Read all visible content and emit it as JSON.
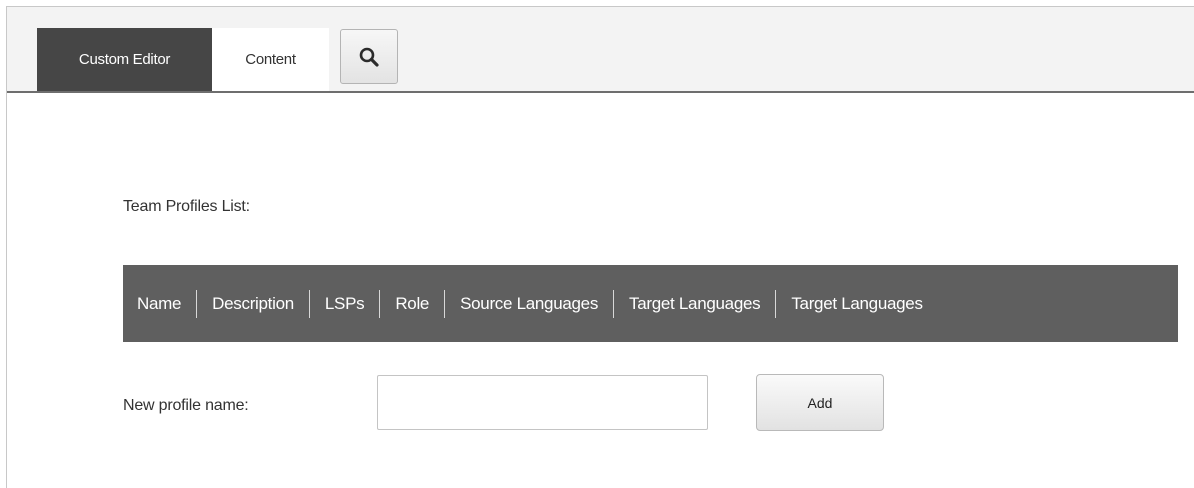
{
  "tabs": {
    "custom_editor": "Custom Editor",
    "content": "Content"
  },
  "toolbar": {
    "search_icon": "search-icon"
  },
  "profiles": {
    "list_title": "Team Profiles List:",
    "columns": [
      "Name",
      "Description",
      "LSPs",
      "Role",
      "Source Languages",
      "Target Languages",
      "Target Languages"
    ]
  },
  "new_profile": {
    "label": "New profile name:",
    "input_value": "",
    "add_label": "Add"
  },
  "colors": {
    "active_tab_bg": "#464646",
    "table_header_bg": "#5f5f5f",
    "toolbar_bg": "#f3f3f3"
  }
}
